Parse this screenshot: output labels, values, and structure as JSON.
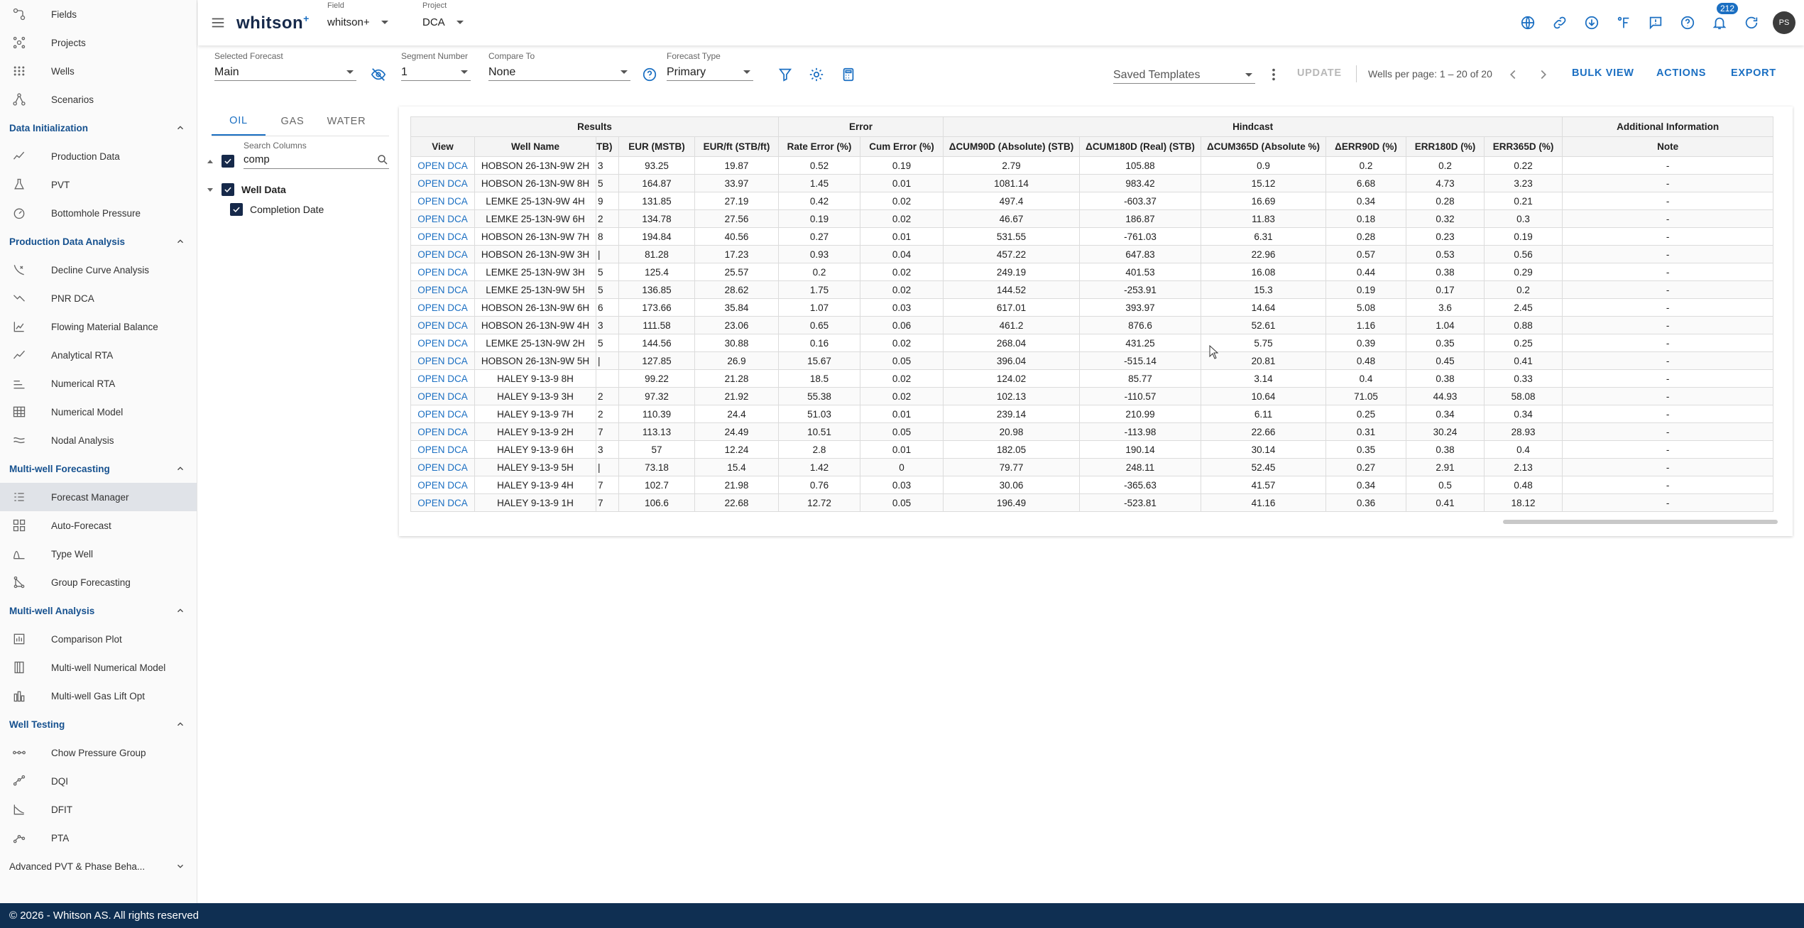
{
  "sidebar": {
    "items": [
      {
        "type": "item",
        "label": "Fields",
        "icon": "fields-icon"
      },
      {
        "type": "item",
        "label": "Projects",
        "icon": "projects-icon"
      },
      {
        "type": "item",
        "label": "Wells",
        "icon": "wells-icon"
      },
      {
        "type": "item",
        "label": "Scenarios",
        "icon": "scenarios-icon"
      },
      {
        "type": "section",
        "label": "Data Initialization",
        "expanded": true
      },
      {
        "type": "item",
        "label": "Production Data",
        "icon": "production-data-icon"
      },
      {
        "type": "item",
        "label": "PVT",
        "icon": "pvt-icon"
      },
      {
        "type": "item",
        "label": "Bottomhole Pressure",
        "icon": "bottomhole-pressure-icon"
      },
      {
        "type": "section",
        "label": "Production Data Analysis",
        "expanded": true
      },
      {
        "type": "item",
        "label": "Decline Curve Analysis",
        "icon": "decline-curve-icon"
      },
      {
        "type": "item",
        "label": "PNR DCA",
        "icon": "pnr-dca-icon"
      },
      {
        "type": "item",
        "label": "Flowing Material Balance",
        "icon": "flowing-material-balance-icon"
      },
      {
        "type": "item",
        "label": "Analytical RTA",
        "icon": "analytical-rta-icon"
      },
      {
        "type": "item",
        "label": "Numerical RTA",
        "icon": "numerical-rta-icon"
      },
      {
        "type": "item",
        "label": "Numerical Model",
        "icon": "numerical-model-icon"
      },
      {
        "type": "item",
        "label": "Nodal Analysis",
        "icon": "nodal-analysis-icon"
      },
      {
        "type": "section",
        "label": "Multi-well Forecasting",
        "expanded": true
      },
      {
        "type": "item",
        "label": "Forecast Manager",
        "icon": "forecast-manager-icon",
        "active": true
      },
      {
        "type": "item",
        "label": "Auto-Forecast",
        "icon": "auto-forecast-icon"
      },
      {
        "type": "item",
        "label": "Type Well",
        "icon": "type-well-icon"
      },
      {
        "type": "item",
        "label": "Group Forecasting",
        "icon": "group-forecasting-icon"
      },
      {
        "type": "section",
        "label": "Multi-well Analysis",
        "expanded": true
      },
      {
        "type": "item",
        "label": "Comparison Plot",
        "icon": "comparison-plot-icon"
      },
      {
        "type": "item",
        "label": "Multi-well Numerical Model",
        "icon": "multiwell-numerical-model-icon"
      },
      {
        "type": "item",
        "label": "Multi-well Gas Lift Opt",
        "icon": "gas-lift-icon"
      },
      {
        "type": "section",
        "label": "Well Testing",
        "expanded": true
      },
      {
        "type": "item",
        "label": "Chow Pressure Group",
        "icon": "chow-pressure-icon"
      },
      {
        "type": "item",
        "label": "DQI",
        "icon": "dqi-icon"
      },
      {
        "type": "item",
        "label": "DFIT",
        "icon": "dfit-icon"
      },
      {
        "type": "item",
        "label": "PTA",
        "icon": "pta-icon"
      },
      {
        "type": "section",
        "label": "Advanced PVT & Phase Beha...",
        "expanded": false
      }
    ]
  },
  "header": {
    "logo": "whitson",
    "logo_sup": "+",
    "field_label": "Field",
    "field_value": "whitson+",
    "project_label": "Project",
    "project_value": "DCA",
    "notification_count": "212",
    "avatar_initials": "PS",
    "icons": [
      "globe-icon",
      "link-icon",
      "download-icon",
      "fahrenheit-icon",
      "feedback-icon",
      "help-icon",
      "bell-icon",
      "refresh-icon"
    ]
  },
  "toolbar": {
    "selected_forecast_label": "Selected Forecast",
    "selected_forecast_value": "Main",
    "segment_number_label": "Segment Number",
    "segment_number_value": "1",
    "compare_to_label": "Compare To",
    "compare_to_value": "None",
    "forecast_type_label": "Forecast Type",
    "forecast_type_value": "Primary",
    "saved_templates_placeholder": "Saved Templates",
    "update_label": "UPDATE",
    "wells_per_page_text": "Wells per page: 1 – 20 of 20",
    "bulk_view_label": "BULK VIEW",
    "actions_label": "ACTIONS",
    "export_label": "EXPORT"
  },
  "columns_panel": {
    "tabs": [
      "OIL",
      "GAS",
      "WATER"
    ],
    "active_tab": "OIL",
    "search_label": "Search Columns",
    "search_value": "comp",
    "group_label": "Well Data",
    "column_label": "Completion Date"
  },
  "table": {
    "groups": [
      {
        "label": "Results",
        "span": 5
      },
      {
        "label": "Error",
        "span": 2
      },
      {
        "label": "Hindcast",
        "span": 6
      },
      {
        "label": "Additional Information",
        "span": 1
      }
    ],
    "headers": [
      "View",
      "Well Name",
      "TB)",
      "EUR (MSTB)",
      "EUR/ft (STB/ft)",
      "Rate Error (%)",
      "Cum Error (%)",
      "ΔCUM90D (Absolute) (STB)",
      "ΔCUM180D (Real) (STB)",
      "ΔCUM365D (Absolute %)",
      "ΔERR90D (%)",
      "ERR180D (%)",
      "ERR365D (%)",
      "Note"
    ],
    "rows": [
      [
        "OPEN DCA",
        "HOBSON 26-13N-9W 2H",
        "3",
        "93.25",
        "19.87",
        "0.52",
        "0.19",
        "2.79",
        "105.88",
        "0.9",
        "0.2",
        "0.2",
        "0.22",
        "-"
      ],
      [
        "OPEN DCA",
        "HOBSON 26-13N-9W 8H",
        "5",
        "164.87",
        "33.97",
        "1.45",
        "0.01",
        "1081.14",
        "983.42",
        "15.12",
        "6.68",
        "4.73",
        "3.23",
        "-"
      ],
      [
        "OPEN DCA",
        "LEMKE 25-13N-9W 4H",
        "9",
        "131.85",
        "27.19",
        "0.42",
        "0.02",
        "497.4",
        "-603.37",
        "16.69",
        "0.34",
        "0.28",
        "0.21",
        "-"
      ],
      [
        "OPEN DCA",
        "LEMKE 25-13N-9W 6H",
        "2",
        "134.78",
        "27.56",
        "0.19",
        "0.02",
        "46.67",
        "186.87",
        "11.83",
        "0.18",
        "0.32",
        "0.3",
        "-"
      ],
      [
        "OPEN DCA",
        "HOBSON 26-13N-9W 7H",
        "8",
        "194.84",
        "40.56",
        "0.27",
        "0.01",
        "531.55",
        "-761.03",
        "6.31",
        "0.28",
        "0.23",
        "0.19",
        "-"
      ],
      [
        "OPEN DCA",
        "HOBSON 26-13N-9W 3H",
        "|",
        "81.28",
        "17.23",
        "0.93",
        "0.04",
        "457.22",
        "647.83",
        "22.96",
        "0.57",
        "0.53",
        "0.56",
        "-"
      ],
      [
        "OPEN DCA",
        "LEMKE 25-13N-9W 3H",
        "5",
        "125.4",
        "25.57",
        "0.2",
        "0.02",
        "249.19",
        "401.53",
        "16.08",
        "0.44",
        "0.38",
        "0.29",
        "-"
      ],
      [
        "OPEN DCA",
        "LEMKE 25-13N-9W 5H",
        "5",
        "136.85",
        "28.62",
        "1.75",
        "0.02",
        "144.52",
        "-253.91",
        "15.3",
        "0.19",
        "0.17",
        "0.2",
        "-"
      ],
      [
        "OPEN DCA",
        "HOBSON 26-13N-9W 6H",
        "6",
        "173.66",
        "35.84",
        "1.07",
        "0.03",
        "617.01",
        "393.97",
        "14.64",
        "5.08",
        "3.6",
        "2.45",
        "-"
      ],
      [
        "OPEN DCA",
        "HOBSON 26-13N-9W 4H",
        "3",
        "111.58",
        "23.06",
        "0.65",
        "0.06",
        "461.2",
        "876.6",
        "52.61",
        "1.16",
        "1.04",
        "0.88",
        "-"
      ],
      [
        "OPEN DCA",
        "LEMKE 25-13N-9W 2H",
        "5",
        "144.56",
        "30.88",
        "0.16",
        "0.02",
        "268.04",
        "431.25",
        "5.75",
        "0.39",
        "0.35",
        "0.25",
        "-"
      ],
      [
        "OPEN DCA",
        "HOBSON 26-13N-9W 5H",
        "|",
        "127.85",
        "26.9",
        "15.67",
        "0.05",
        "396.04",
        "-515.14",
        "20.81",
        "0.48",
        "0.45",
        "0.41",
        "-"
      ],
      [
        "OPEN DCA",
        "HALEY 9-13-9 8H",
        "",
        "99.22",
        "21.28",
        "18.5",
        "0.02",
        "124.02",
        "85.77",
        "3.14",
        "0.4",
        "0.38",
        "0.33",
        "-"
      ],
      [
        "OPEN DCA",
        "HALEY 9-13-9 3H",
        "2",
        "97.32",
        "21.92",
        "55.38",
        "0.02",
        "102.13",
        "-110.57",
        "10.64",
        "71.05",
        "44.93",
        "58.08",
        "-"
      ],
      [
        "OPEN DCA",
        "HALEY 9-13-9 7H",
        "2",
        "110.39",
        "24.4",
        "51.03",
        "0.01",
        "239.14",
        "210.99",
        "6.11",
        "0.25",
        "0.34",
        "0.34",
        "-"
      ],
      [
        "OPEN DCA",
        "HALEY 9-13-9 2H",
        "7",
        "113.13",
        "24.49",
        "10.51",
        "0.05",
        "20.98",
        "-113.98",
        "22.66",
        "0.31",
        "30.24",
        "28.93",
        "-"
      ],
      [
        "OPEN DCA",
        "HALEY 9-13-9 6H",
        "3",
        "57",
        "12.24",
        "2.8",
        "0.01",
        "182.05",
        "190.14",
        "30.14",
        "0.35",
        "0.38",
        "0.4",
        "-"
      ],
      [
        "OPEN DCA",
        "HALEY 9-13-9 5H",
        "|",
        "73.18",
        "15.4",
        "1.42",
        "0",
        "79.77",
        "248.11",
        "52.45",
        "0.27",
        "2.91",
        "2.13",
        "-"
      ],
      [
        "OPEN DCA",
        "HALEY 9-13-9 4H",
        "7",
        "102.7",
        "21.98",
        "0.76",
        "0.03",
        "30.06",
        "-365.63",
        "41.57",
        "0.34",
        "0.5",
        "0.48",
        "-"
      ],
      [
        "OPEN DCA",
        "HALEY 9-13-9 1H",
        "7",
        "106.6",
        "22.68",
        "12.72",
        "0.05",
        "196.49",
        "-523.81",
        "41.16",
        "0.36",
        "0.41",
        "18.12",
        "-"
      ]
    ]
  },
  "footer": {
    "text": "© 2026 - Whitson AS. All rights reserved"
  }
}
